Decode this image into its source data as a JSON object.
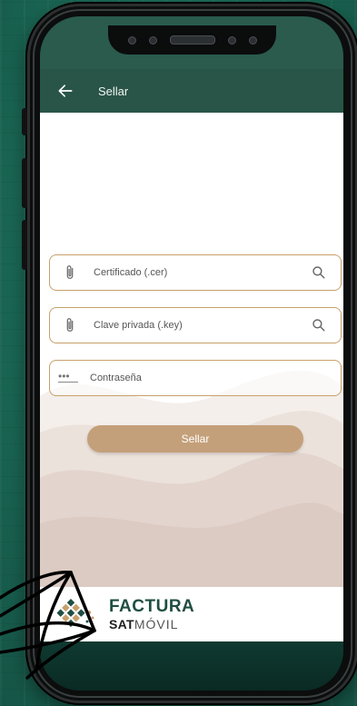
{
  "appbar": {
    "title": "Sellar"
  },
  "form": {
    "certificate_label": "Certificado (.cer)",
    "private_key_label": "Clave privada (.key)",
    "password_label": "Contraseña",
    "password_mask": "•••",
    "submit_label": "Sellar"
  },
  "footer": {
    "brand_top": "FACTURA",
    "brand_sat": "SAT",
    "brand_movil": "MÓVIL"
  },
  "icons": {
    "back": "arrow-left-icon",
    "attach": "paperclip-icon",
    "search": "search-icon",
    "password": "password-dots-icon"
  },
  "colors": {
    "appbar": "#285547",
    "accent": "#c7a06b",
    "button": "#c4a07a",
    "brand": "#1f4e41"
  }
}
